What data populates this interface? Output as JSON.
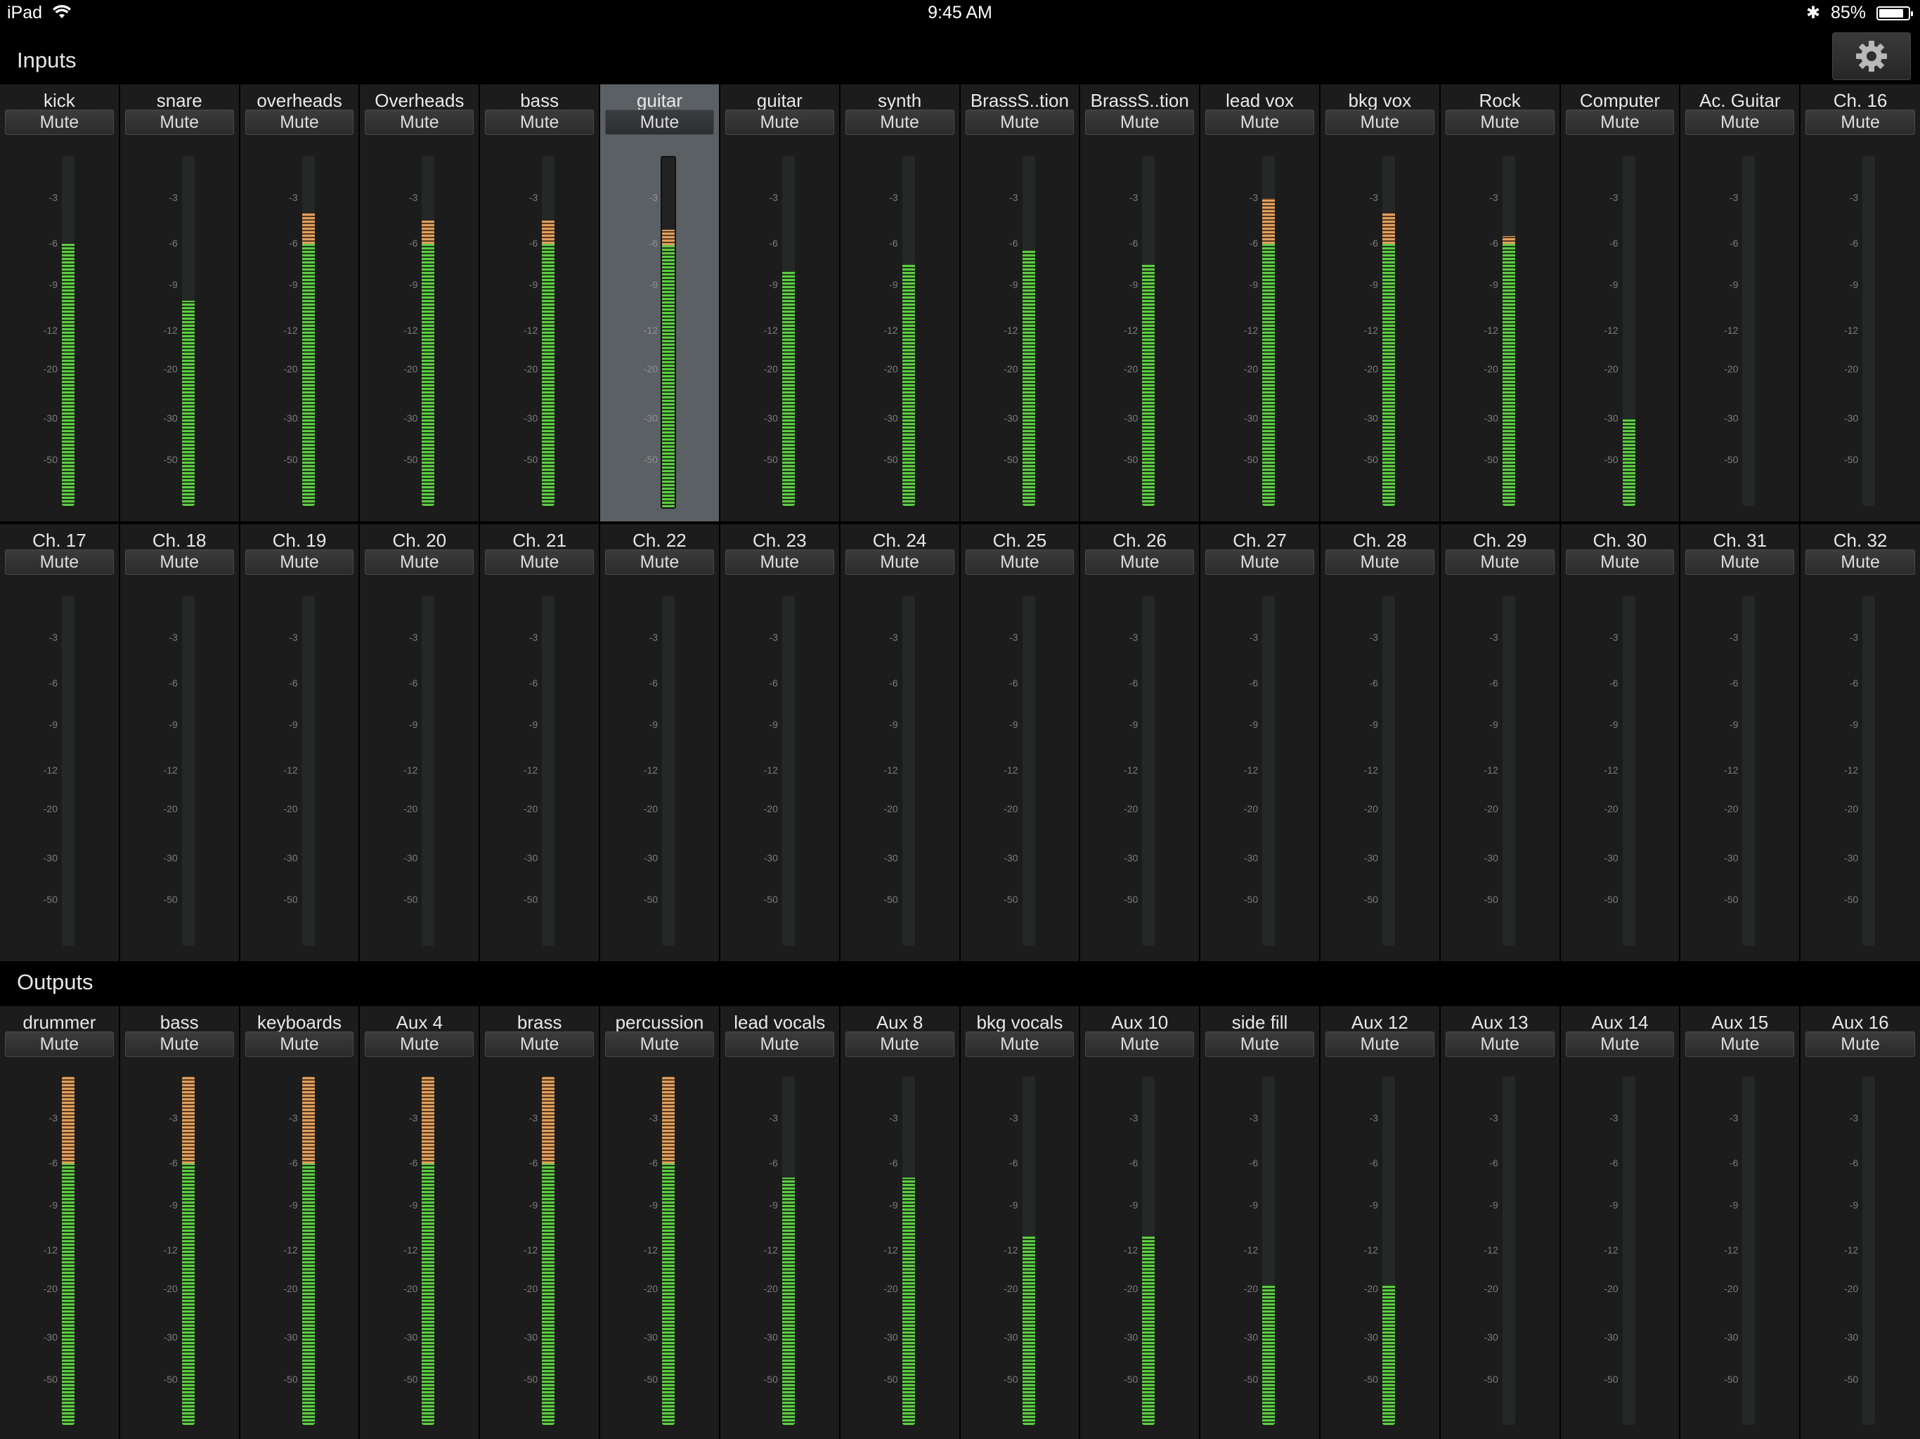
{
  "status_bar": {
    "device": "iPad",
    "time": "9:45 AM",
    "battery": "85%",
    "battery_level": 0.85
  },
  "inputs_title": "Inputs",
  "outputs_title": "Outputs",
  "mute_label": "Mute",
  "scale_labels": [
    "-3",
    "-6",
    "-9",
    "-12",
    "-20",
    "-30",
    "-50"
  ],
  "colors": {
    "green": "#5fcc45",
    "orange": "#e0a060",
    "selected": "#5b6064"
  },
  "inputs_row1": [
    {
      "name": "kick",
      "level_db": -6
    },
    {
      "name": "snare",
      "level_db": -10
    },
    {
      "name": "overheads",
      "level_db": -4
    },
    {
      "name": "Overheads",
      "level_db": -4.5
    },
    {
      "name": "bass",
      "level_db": -4.5
    },
    {
      "name": "guitar",
      "level_db": -5,
      "selected": true
    },
    {
      "name": "guitar",
      "level_db": -8
    },
    {
      "name": "synth",
      "level_db": -7.5
    },
    {
      "name": "BrassS..tion",
      "level_db": -6.5
    },
    {
      "name": "BrassS..tion",
      "level_db": -7.5
    },
    {
      "name": "lead vox",
      "level_db": -3
    },
    {
      "name": "bkg vox",
      "level_db": -4
    },
    {
      "name": "Rock",
      "level_db": -5.5
    },
    {
      "name": "Computer",
      "level_db": -30
    },
    {
      "name": "Ac. Guitar",
      "level_db": null
    },
    {
      "name": "Ch. 16",
      "level_db": null
    }
  ],
  "inputs_row2": [
    {
      "name": "Ch. 17",
      "level_db": null
    },
    {
      "name": "Ch. 18",
      "level_db": null
    },
    {
      "name": "Ch. 19",
      "level_db": null
    },
    {
      "name": "Ch. 20",
      "level_db": null
    },
    {
      "name": "Ch. 21",
      "level_db": null
    },
    {
      "name": "Ch. 22",
      "level_db": null
    },
    {
      "name": "Ch. 23",
      "level_db": null
    },
    {
      "name": "Ch. 24",
      "level_db": null
    },
    {
      "name": "Ch. 25",
      "level_db": null
    },
    {
      "name": "Ch. 26",
      "level_db": null
    },
    {
      "name": "Ch. 27",
      "level_db": null
    },
    {
      "name": "Ch. 28",
      "level_db": null
    },
    {
      "name": "Ch. 29",
      "level_db": null
    },
    {
      "name": "Ch. 30",
      "level_db": null
    },
    {
      "name": "Ch. 31",
      "level_db": null
    },
    {
      "name": "Ch. 32",
      "level_db": null
    }
  ],
  "outputs": [
    {
      "name": "drummer",
      "level_db": 0
    },
    {
      "name": "bass",
      "level_db": 0
    },
    {
      "name": "keyboards",
      "level_db": 0
    },
    {
      "name": "Aux 4",
      "level_db": 0
    },
    {
      "name": "brass",
      "level_db": 0
    },
    {
      "name": "percussion",
      "level_db": 0
    },
    {
      "name": "lead vocals",
      "level_db": -7
    },
    {
      "name": "Aux 8",
      "level_db": -7
    },
    {
      "name": "bkg vocals",
      "level_db": -11
    },
    {
      "name": "Aux 10",
      "level_db": -11
    },
    {
      "name": "side fill",
      "level_db": -19
    },
    {
      "name": "Aux 12",
      "level_db": -19
    },
    {
      "name": "Aux 13",
      "level_db": null
    },
    {
      "name": "Aux 14",
      "level_db": null
    },
    {
      "name": "Aux 15",
      "level_db": null
    },
    {
      "name": "Aux 16",
      "level_db": null
    }
  ]
}
